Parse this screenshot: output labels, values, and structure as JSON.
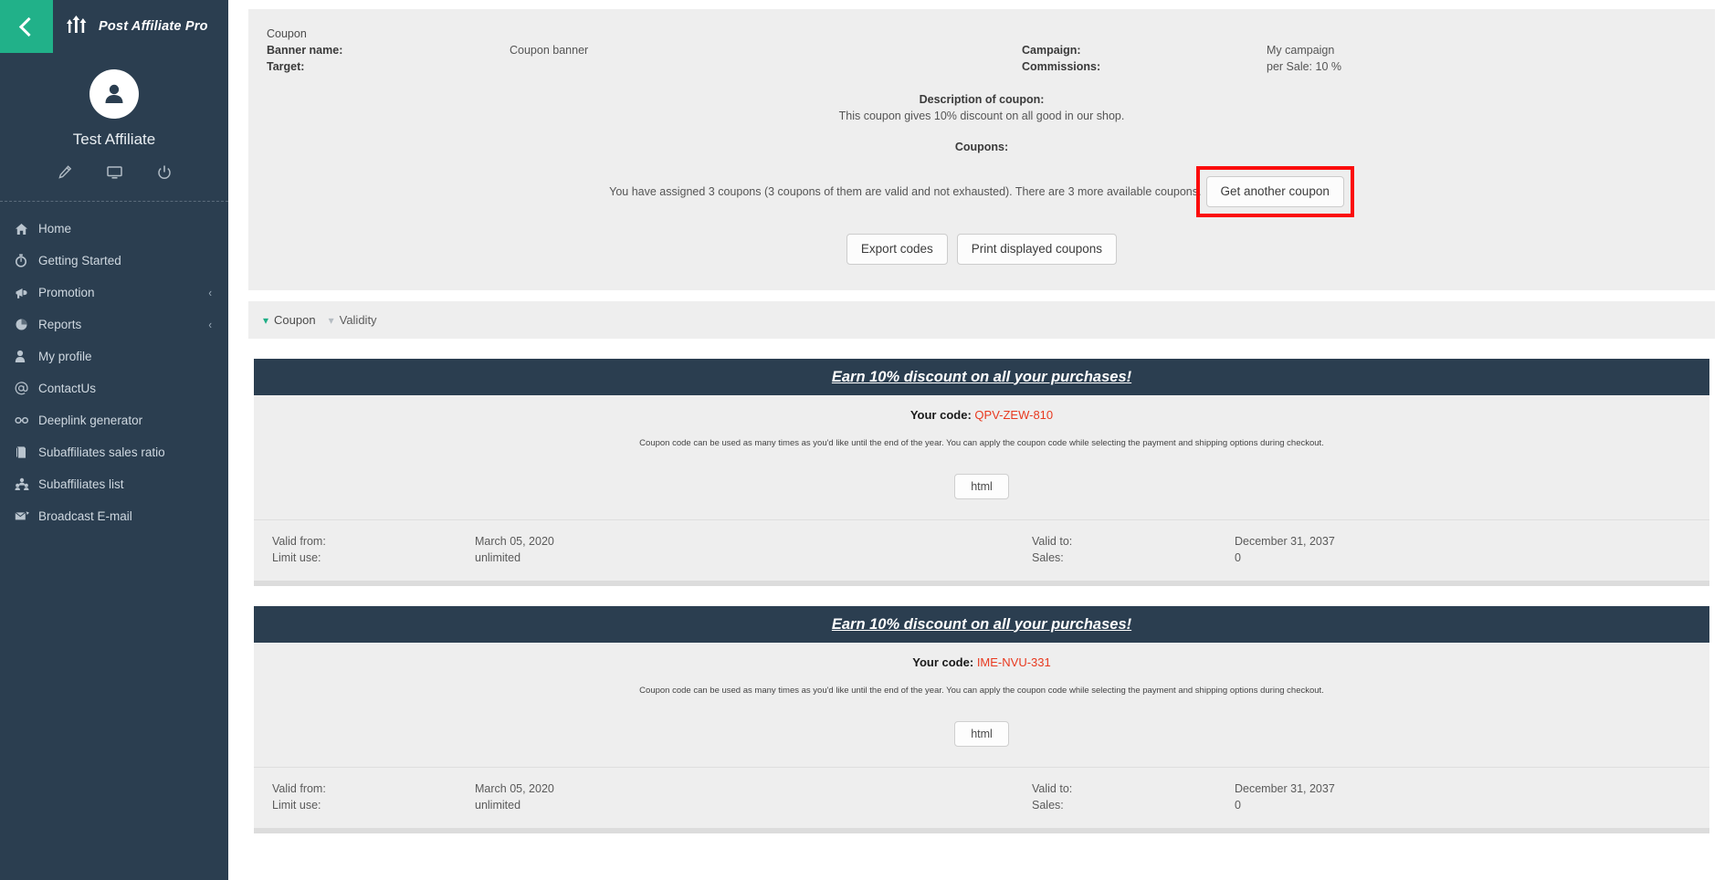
{
  "sidebar": {
    "collapse_icon": "chevron-left-icon",
    "brand": "Post Affiliate Pro",
    "affiliate_name": "Test Affiliate",
    "profile_actions": [
      {
        "name": "edit-profile-icon",
        "glyph": "pencil-icon"
      },
      {
        "name": "desktop-icon",
        "glyph": "monitor-icon"
      },
      {
        "name": "logout-icon",
        "glyph": "power-icon"
      }
    ],
    "items": [
      {
        "label": "Home",
        "icon": "home-icon",
        "caret": ""
      },
      {
        "label": "Getting Started",
        "icon": "stopwatch-icon",
        "caret": ""
      },
      {
        "label": "Promotion",
        "icon": "megaphone-icon",
        "caret": "‹"
      },
      {
        "label": "Reports",
        "icon": "chart-pie-icon",
        "caret": "‹"
      },
      {
        "label": "My profile",
        "icon": "user-icon",
        "caret": ""
      },
      {
        "label": "ContactUs",
        "icon": "at-icon",
        "caret": ""
      },
      {
        "label": "Deeplink generator",
        "icon": "link-icon",
        "caret": ""
      },
      {
        "label": "Subaffiliates sales ratio",
        "icon": "book-icon",
        "caret": ""
      },
      {
        "label": "Subaffiliates list",
        "icon": "people-icon",
        "caret": ""
      },
      {
        "label": "Broadcast E-mail",
        "icon": "mail-icon",
        "caret": ""
      }
    ]
  },
  "header": {
    "section_title": "Coupon",
    "banner_name_label": "Banner name:",
    "banner_name_value": "Coupon banner",
    "target_label": "Target:",
    "target_value": "",
    "campaign_label": "Campaign:",
    "campaign_value": "My campaign",
    "commissions_label": "Commissions:",
    "commissions_value": "per Sale: 10 %"
  },
  "description": {
    "title": "Description of coupon:",
    "text": "This coupon gives 10% discount on all good in our shop.",
    "coupons_title": "Coupons:",
    "assigned_text": "You have assigned 3 coupons (3 coupons of them are valid and not exhausted). There are 3 more available coupons.",
    "get_another_coupon_label": "Get another coupon",
    "export_codes_label": "Export codes",
    "print_displayed_label": "Print displayed coupons",
    "highlight_color": "#fb0c0c"
  },
  "filters": {
    "coupon_label": "Coupon",
    "validity_label": "Validity",
    "active_caret_color": "#1fae86"
  },
  "coupons": [
    {
      "banner_text": "Earn 10% discount on all your purchases!",
      "code_label": "Your code:",
      "code": "QPV-ZEW-810",
      "code_color": "#e8391f",
      "note": "Coupon code can be used as many times as you'd like until the end of the year. You can apply the coupon code while selecting the payment and shipping options during checkout.",
      "format_button": "html",
      "valid_from_label": "Valid from:",
      "valid_from_value": "March 05, 2020",
      "limit_use_label": "Limit use:",
      "limit_use_value": "unlimited",
      "valid_to_label": "Valid to:",
      "valid_to_value": "December 31, 2037",
      "sales_label": "Sales:",
      "sales_value": "0"
    },
    {
      "banner_text": "Earn 10% discount on all your purchases!",
      "code_label": "Your code:",
      "code": "IME-NVU-331",
      "code_color": "#e8391f",
      "note": "Coupon code can be used as many times as you'd like until the end of the year. You can apply the coupon code while selecting the payment and shipping options during checkout.",
      "format_button": "html",
      "valid_from_label": "Valid from:",
      "valid_from_value": "March 05, 2020",
      "limit_use_label": "Limit use:",
      "limit_use_value": "unlimited",
      "valid_to_label": "Valid to:",
      "valid_to_value": "December 31, 2037",
      "sales_label": "Sales:",
      "sales_value": "0"
    }
  ]
}
